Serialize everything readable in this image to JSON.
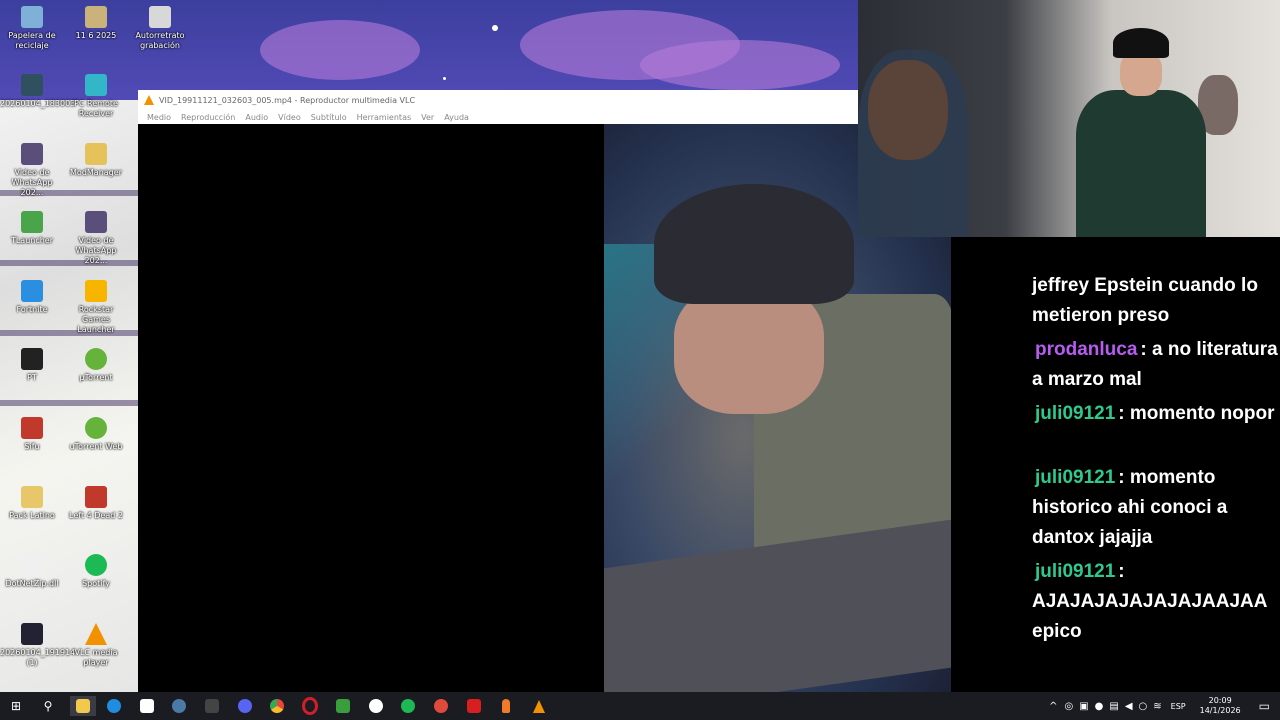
{
  "desktop": {
    "icons": [
      {
        "label": "Papelera de reciclaje",
        "color": "#7fb0d8"
      },
      {
        "label": "11 6 2025",
        "color": "#c9b37a"
      },
      {
        "label": "Autorretrato grabación",
        "color": "#d8d8d8"
      },
      {
        "label": "20260104_183003",
        "color": "#305060"
      },
      {
        "label": "PC Remote Receiver",
        "color": "#33b6c7"
      },
      {
        "label": "Video de WhatsApp 202...",
        "color": "#5a4f7a"
      },
      {
        "label": "ModManager",
        "color": "#e6c35a"
      },
      {
        "label": "TLauncher",
        "color": "#4aa54a"
      },
      {
        "label": "Video de WhatsApp 202...",
        "color": "#5a4f7a"
      },
      {
        "label": "Fortnite",
        "color": "#2a8fe0"
      },
      {
        "label": "Rockstar Games Launcher",
        "color": "#f7b500"
      },
      {
        "label": "PT",
        "color": "#222"
      },
      {
        "label": "µTorrent",
        "color": "#66b33c"
      },
      {
        "label": "Sifu",
        "color": "#c0392b"
      },
      {
        "label": "uTorrent Web",
        "color": "#66b33c"
      },
      {
        "label": "Pack Latino",
        "color": "#e8c66a"
      },
      {
        "label": "Left 4 Dead 2",
        "color": "#c0392b"
      },
      {
        "label": "DotNetZip.dll",
        "color": "#f0f0f0"
      },
      {
        "label": "Spotify",
        "color": "#1db954"
      },
      {
        "label": "20260104_191914 (1)",
        "color": "#223"
      },
      {
        "label": "VLC media player",
        "color": "#f39200"
      }
    ]
  },
  "vlc": {
    "title": "VID_19911121_032603_005.mp4 - Reproductor multimedia VLC",
    "menu": [
      "Medio",
      "Reproducción",
      "Audio",
      "Vídeo",
      "Subtítulo",
      "Herramientas",
      "Ver",
      "Ayuda"
    ]
  },
  "chat": {
    "messages": [
      {
        "user": "",
        "user_color": "",
        "text": "jeffrey Epstein cuando lo metieron preso"
      },
      {
        "user": "prodanluca",
        "user_color": "#b65cf0",
        "text": ": a no literatura a marzo mal"
      },
      {
        "user": "juli09121",
        "user_color": "#2ec98e",
        "text": ": momento nopor"
      },
      {
        "user": "juli09121",
        "user_color": "#2ec98e",
        "text": ": momento historico ahi conoci a dantox jajajja"
      },
      {
        "user": "juli09121",
        "user_color": "#2ec98e",
        "text": ": AJAJAJAJAJAJAJAAJAA epico"
      }
    ]
  },
  "taskbar": {
    "apps": [
      {
        "name": "start",
        "glyph": "⊞",
        "color": "#ffffff"
      },
      {
        "name": "search",
        "glyph": "⚲",
        "color": "#ffffff"
      },
      {
        "name": "file-explorer",
        "glyph": "",
        "color": "#f2c94c"
      },
      {
        "name": "edge",
        "glyph": "",
        "color": "#1f8de0"
      },
      {
        "name": "store",
        "glyph": "",
        "color": "#ffffff"
      },
      {
        "name": "steam",
        "glyph": "",
        "color": "#1b2838"
      },
      {
        "name": "epic-games",
        "glyph": "",
        "color": "#2a2a2a"
      },
      {
        "name": "discord",
        "glyph": "",
        "color": "#5865f2"
      },
      {
        "name": "chrome",
        "glyph": "",
        "color": "#e8453c"
      },
      {
        "name": "opera",
        "glyph": "",
        "color": "#d01f2b"
      },
      {
        "name": "xbox",
        "glyph": "",
        "color": "#3a9e3a"
      },
      {
        "name": "xbox-app",
        "glyph": "",
        "color": "#ffffff"
      },
      {
        "name": "spotify",
        "glyph": "",
        "color": "#1db954"
      },
      {
        "name": "clock-app",
        "glyph": "",
        "color": "#e04a3c"
      },
      {
        "name": "recorder",
        "glyph": "",
        "color": "#d81e1e"
      },
      {
        "name": "microphone",
        "glyph": "",
        "color": "#f07a2a"
      },
      {
        "name": "vlc",
        "glyph": "",
        "color": "#f39200"
      }
    ],
    "language": "ESP",
    "time": "20:09",
    "date": "14/1/2026"
  }
}
